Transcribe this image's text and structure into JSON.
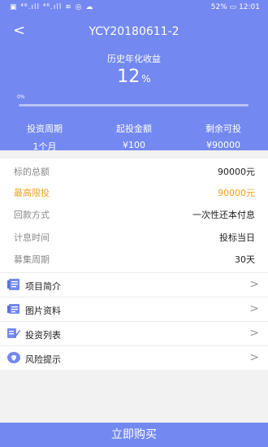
{
  "status_bar": {
    "left": "▣ ⁴⁶.ıll ⁴⁶.ıll ≋ ◎ ☁",
    "battery": "52%",
    "time": "12:01"
  },
  "header": {
    "back_glyph": "<",
    "title": "YCY20180611-2"
  },
  "yield": {
    "label": "历史年化收益",
    "value": "12",
    "unit": "%"
  },
  "progress": {
    "label": "0%",
    "fraction": 0.0
  },
  "stats": [
    {
      "label": "投资周期",
      "value": "1个月"
    },
    {
      "label": "起投金额",
      "value": "¥100"
    },
    {
      "label": "剩余可投",
      "value": "¥90000"
    }
  ],
  "details": [
    {
      "key": "标的总额",
      "value": "90000元"
    },
    {
      "key": "最高限投",
      "value": "90000元"
    },
    {
      "key": "回款方式",
      "value": "一次性还本付息"
    },
    {
      "key": "计息时间",
      "value": "投标当日"
    },
    {
      "key": "募集周期",
      "value": "30天"
    }
  ],
  "menu": [
    {
      "label": "项目简介",
      "icon": "document-icon"
    },
    {
      "label": "图片资料",
      "icon": "image-doc-icon"
    },
    {
      "label": "投资列表",
      "icon": "edit-list-icon"
    },
    {
      "label": "风险提示",
      "icon": "shield-icon"
    }
  ],
  "buy_button": "立即购买",
  "colors": {
    "primary": "#7388f0",
    "highlight": "#f0a01e"
  }
}
